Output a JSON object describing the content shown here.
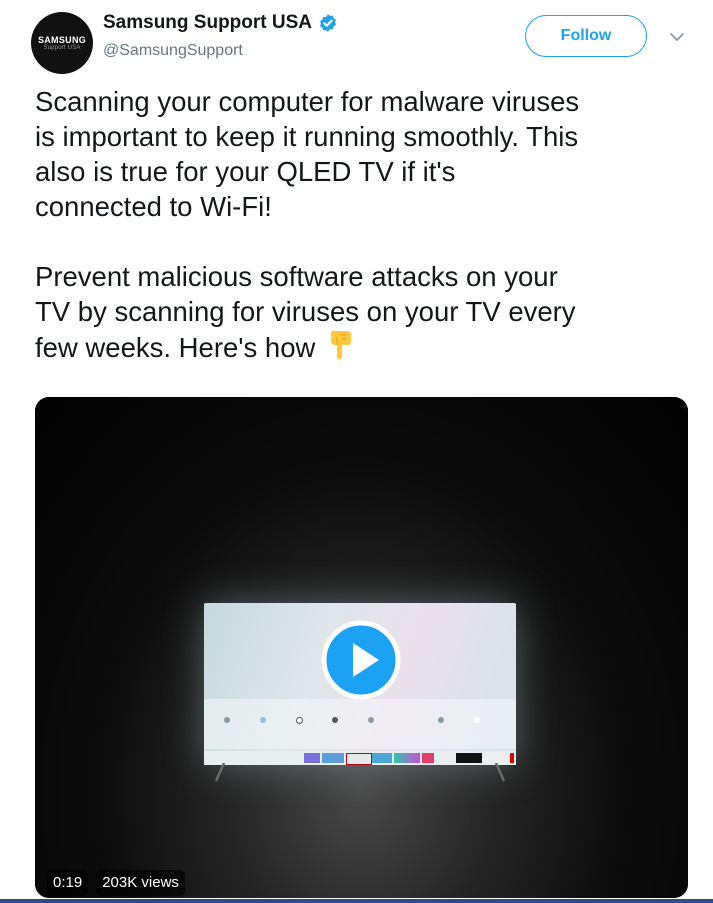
{
  "account": {
    "display_name": "Samsung Support USA",
    "handle": "@SamsungSupport",
    "avatar_brand": "SAMSUNG",
    "avatar_subtext": "Support USA"
  },
  "actions": {
    "follow_label": "Follow"
  },
  "tweet": {
    "paragraph1_lines": [
      "Scanning your computer for malware viruses",
      "is important to keep it running smoothly. This",
      "also is true for your QLED TV if it's",
      "connected to Wi-Fi!"
    ],
    "paragraph2_lines": [
      "Prevent malicious software attacks on your",
      "TV by scanning for viruses on your TV every",
      "few weeks. Here's how"
    ],
    "emoji": "backhand-index-pointing-down"
  },
  "video": {
    "duration": "0:19",
    "views": "203K views",
    "play_icon": "play-icon"
  },
  "colors": {
    "accent": "#1da1f2",
    "text": "#14171a",
    "secondary_text": "#657786",
    "emoji_yellow": "#ffc83d"
  }
}
